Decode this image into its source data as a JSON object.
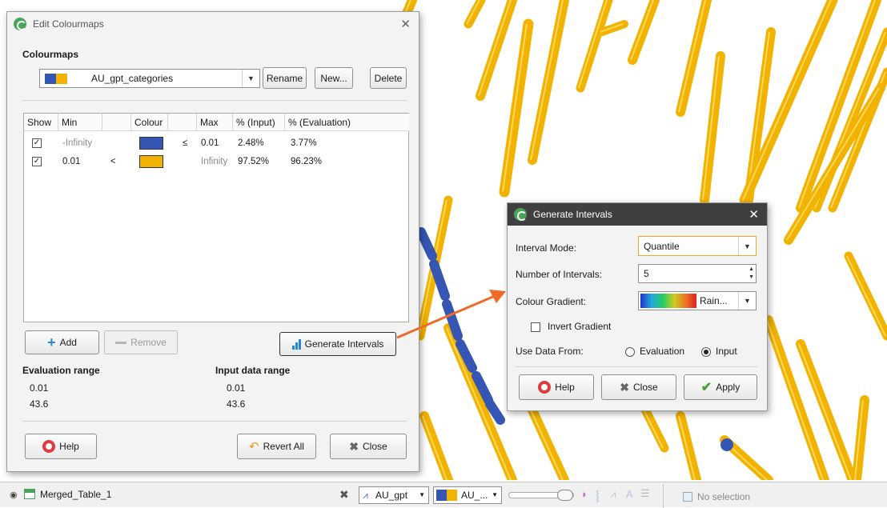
{
  "colors": {
    "tube": "#f2b200",
    "tube_stroke": "#b98700",
    "blue": "#3556b3",
    "arrow": "#f06a2a"
  },
  "edit_dialog": {
    "title": "Edit Colourmaps",
    "colourmaps_label": "Colourmaps",
    "selected_colourmap": "AU_gpt_categories",
    "rename_label": "Rename",
    "new_label": "New...",
    "delete_label": "Delete",
    "table": {
      "headers": [
        "Show",
        "Min",
        "",
        "Colour",
        "",
        "Max",
        "% (Input)",
        "% (Evaluation)"
      ],
      "rows": [
        {
          "show": "✓",
          "min": "-Infinity",
          "op_left": "",
          "colour": "#3556b3",
          "op_right": "≤",
          "max": "0.01",
          "pct_input": "2.48%",
          "pct_eval": "3.77%"
        },
        {
          "show": "✓",
          "min": "0.01",
          "op_left": "<",
          "colour": "#f2b200",
          "op_right": "",
          "max": "Infinity",
          "pct_input": "97.52%",
          "pct_eval": "96.23%"
        }
      ]
    },
    "add_label": "Add",
    "remove_label": "Remove",
    "generate_label": "Generate Intervals",
    "evaluation_range_label": "Evaluation range",
    "eval_min": "0.01",
    "eval_max": "43.6",
    "input_range_label": "Input data range",
    "input_min": "0.01",
    "input_max": "43.6",
    "help_label": "Help",
    "revert_label": "Revert All",
    "close_label": "Close"
  },
  "gen_dialog": {
    "title": "Generate Intervals",
    "interval_mode_label": "Interval Mode:",
    "interval_mode_value": "Quantile",
    "num_intervals_label": "Number of Intervals:",
    "num_intervals_value": "5",
    "gradient_label": "Colour Gradient:",
    "gradient_value": "Rain...",
    "invert_label": "Invert Gradient",
    "use_data_label": "Use Data From:",
    "evaluation_option": "Evaluation",
    "input_option": "Input",
    "help_label": "Help",
    "close_label": "Close",
    "apply_label": "Apply"
  },
  "statusbar": {
    "table_name": "Merged_Table_1",
    "column_select": "AU_gpt",
    "colourmap_select": "AU_...",
    "selection_text": "No selection"
  }
}
